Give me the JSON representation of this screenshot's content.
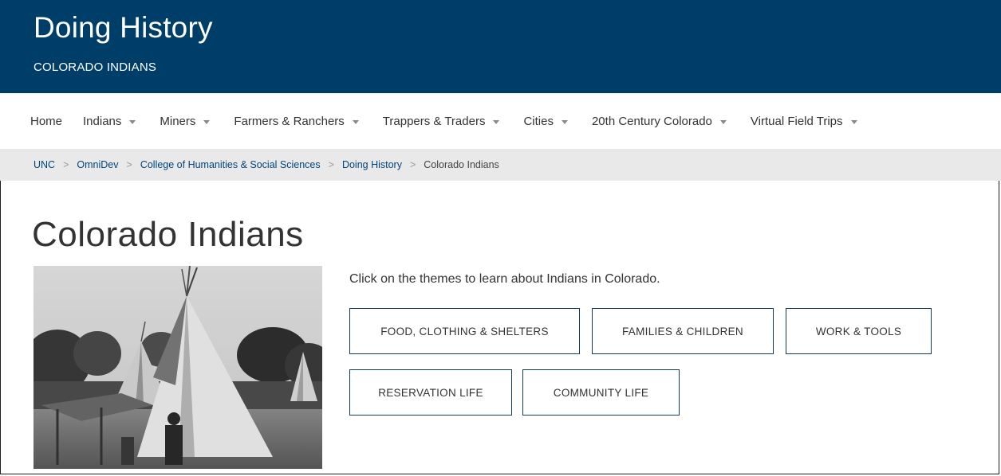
{
  "header": {
    "site_title": "Doing History",
    "site_subtitle": "COLORADO INDIANS"
  },
  "nav": {
    "items": [
      {
        "label": "Home",
        "has_dropdown": false
      },
      {
        "label": "Indians",
        "has_dropdown": true
      },
      {
        "label": "Miners",
        "has_dropdown": true
      },
      {
        "label": "Farmers & Ranchers",
        "has_dropdown": true
      },
      {
        "label": "Trappers & Traders",
        "has_dropdown": true
      },
      {
        "label": "Cities",
        "has_dropdown": true
      },
      {
        "label": "20th Century Colorado",
        "has_dropdown": true
      },
      {
        "label": "Virtual Field Trips",
        "has_dropdown": true
      }
    ]
  },
  "breadcrumb": {
    "separator": ">",
    "items": [
      "UNC",
      "OmniDev",
      "College of Humanities & Social Sciences",
      "Doing History",
      "Colorado Indians"
    ]
  },
  "main": {
    "title": "Colorado Indians",
    "intro": "Click on the themes to learn about Indians in Colorado.",
    "themes": [
      "FOOD, CLOTHING & SHELTERS",
      "FAMILIES & CHILDREN",
      "WORK & TOOLS",
      "RESERVATION LIFE",
      "COMMUNITY LIFE"
    ]
  },
  "colors": {
    "header_bg": "#003e6a",
    "breadcrumb_bg": "#e9e9e9",
    "link": "#00457c",
    "button_border": "#123a5c"
  }
}
